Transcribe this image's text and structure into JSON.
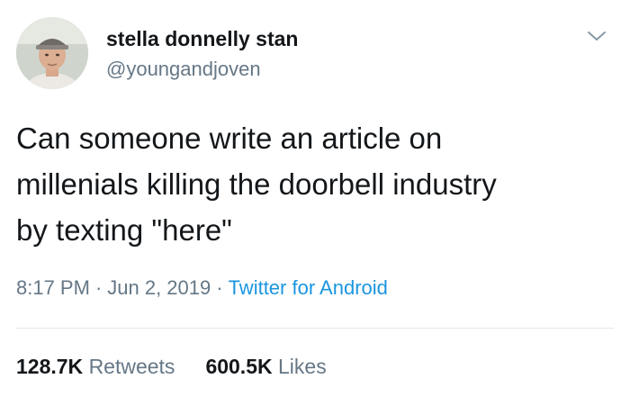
{
  "user": {
    "display_name": "stella donnelly stan",
    "handle": "@youngandjoven",
    "avatar_icon": "user-avatar"
  },
  "tweet": {
    "lines": [
      "Can someone write an article on",
      "millenials killing the doorbell industry",
      "by texting \"here\""
    ],
    "time": "8:17 PM",
    "date": "Jun 2, 2019",
    "separator": "·",
    "source": "Twitter for Android"
  },
  "stats": {
    "retweets_count": "128.7K",
    "retweets_label": "Retweets",
    "likes_count": "600.5K",
    "likes_label": "Likes"
  },
  "menu": {
    "icon": "chevron-down-icon"
  },
  "colors": {
    "text": "#14171a",
    "secondary": "#657786",
    "link": "#1b95e0",
    "divider": "#e1e8ed"
  }
}
